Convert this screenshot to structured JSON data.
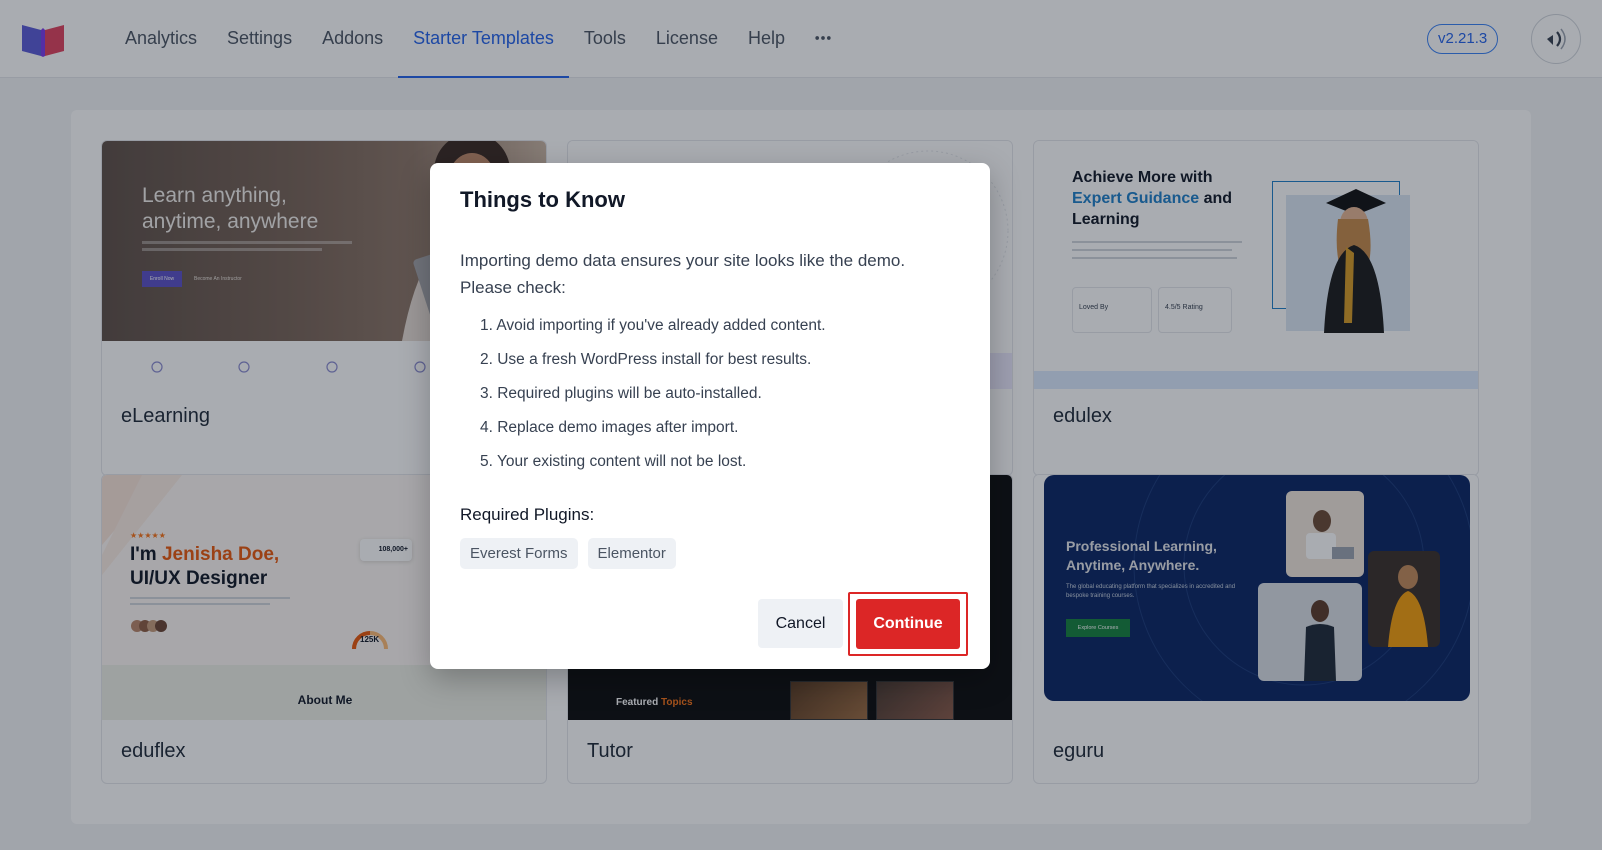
{
  "header": {
    "nav": [
      "Analytics",
      "Settings",
      "Addons",
      "Starter Templates",
      "Tools",
      "License",
      "Help"
    ],
    "active_index": 3,
    "version": "v2.21.3"
  },
  "templates": [
    {
      "name": "eLearning",
      "headline": "Learn anything, anytime, anywhere",
      "cta": "Enroll Now",
      "cta2": "Become An Instructor"
    },
    {
      "name": ""
    },
    {
      "name": "edulex",
      "headline_a": "Achieve More with",
      "headline_b": "Expert Guidance",
      "headline_c": "and",
      "headline_d": "Learning",
      "stat1": "Loved By",
      "stat2": "4.5/5 Rating"
    },
    {
      "name": "eduflex",
      "headline_a": "I'm",
      "headline_b": "Jenisha Doe,",
      "headline_c": "UI/UX Designer",
      "badge_count": "108,000+",
      "gauge": "125K",
      "section": "About Me"
    },
    {
      "name": "Tutor",
      "featured_a": "Featured",
      "featured_b": "Topics"
    },
    {
      "name": "eguru",
      "headline": "Professional Learning, Anytime, Anywhere.",
      "body": "The global educating platform that specializes in accredited and bespoke training courses.",
      "cta": "Explore Courses"
    }
  ],
  "modal": {
    "title": "Things to Know",
    "intro": "Importing demo data ensures your site looks like the demo. Please check:",
    "items": [
      "1. Avoid importing if you've already added content.",
      "2. Use a fresh WordPress install for best results.",
      "3. Required plugins will be auto-installed.",
      "4. Replace demo images after import.",
      "5. Your existing content will not be lost."
    ],
    "required_label": "Required Plugins:",
    "plugins": [
      "Everest Forms",
      "Elementor"
    ],
    "cancel_label": "Cancel",
    "continue_label": "Continue"
  },
  "colors": {
    "accent": "#2563eb",
    "danger": "#dc2626"
  }
}
